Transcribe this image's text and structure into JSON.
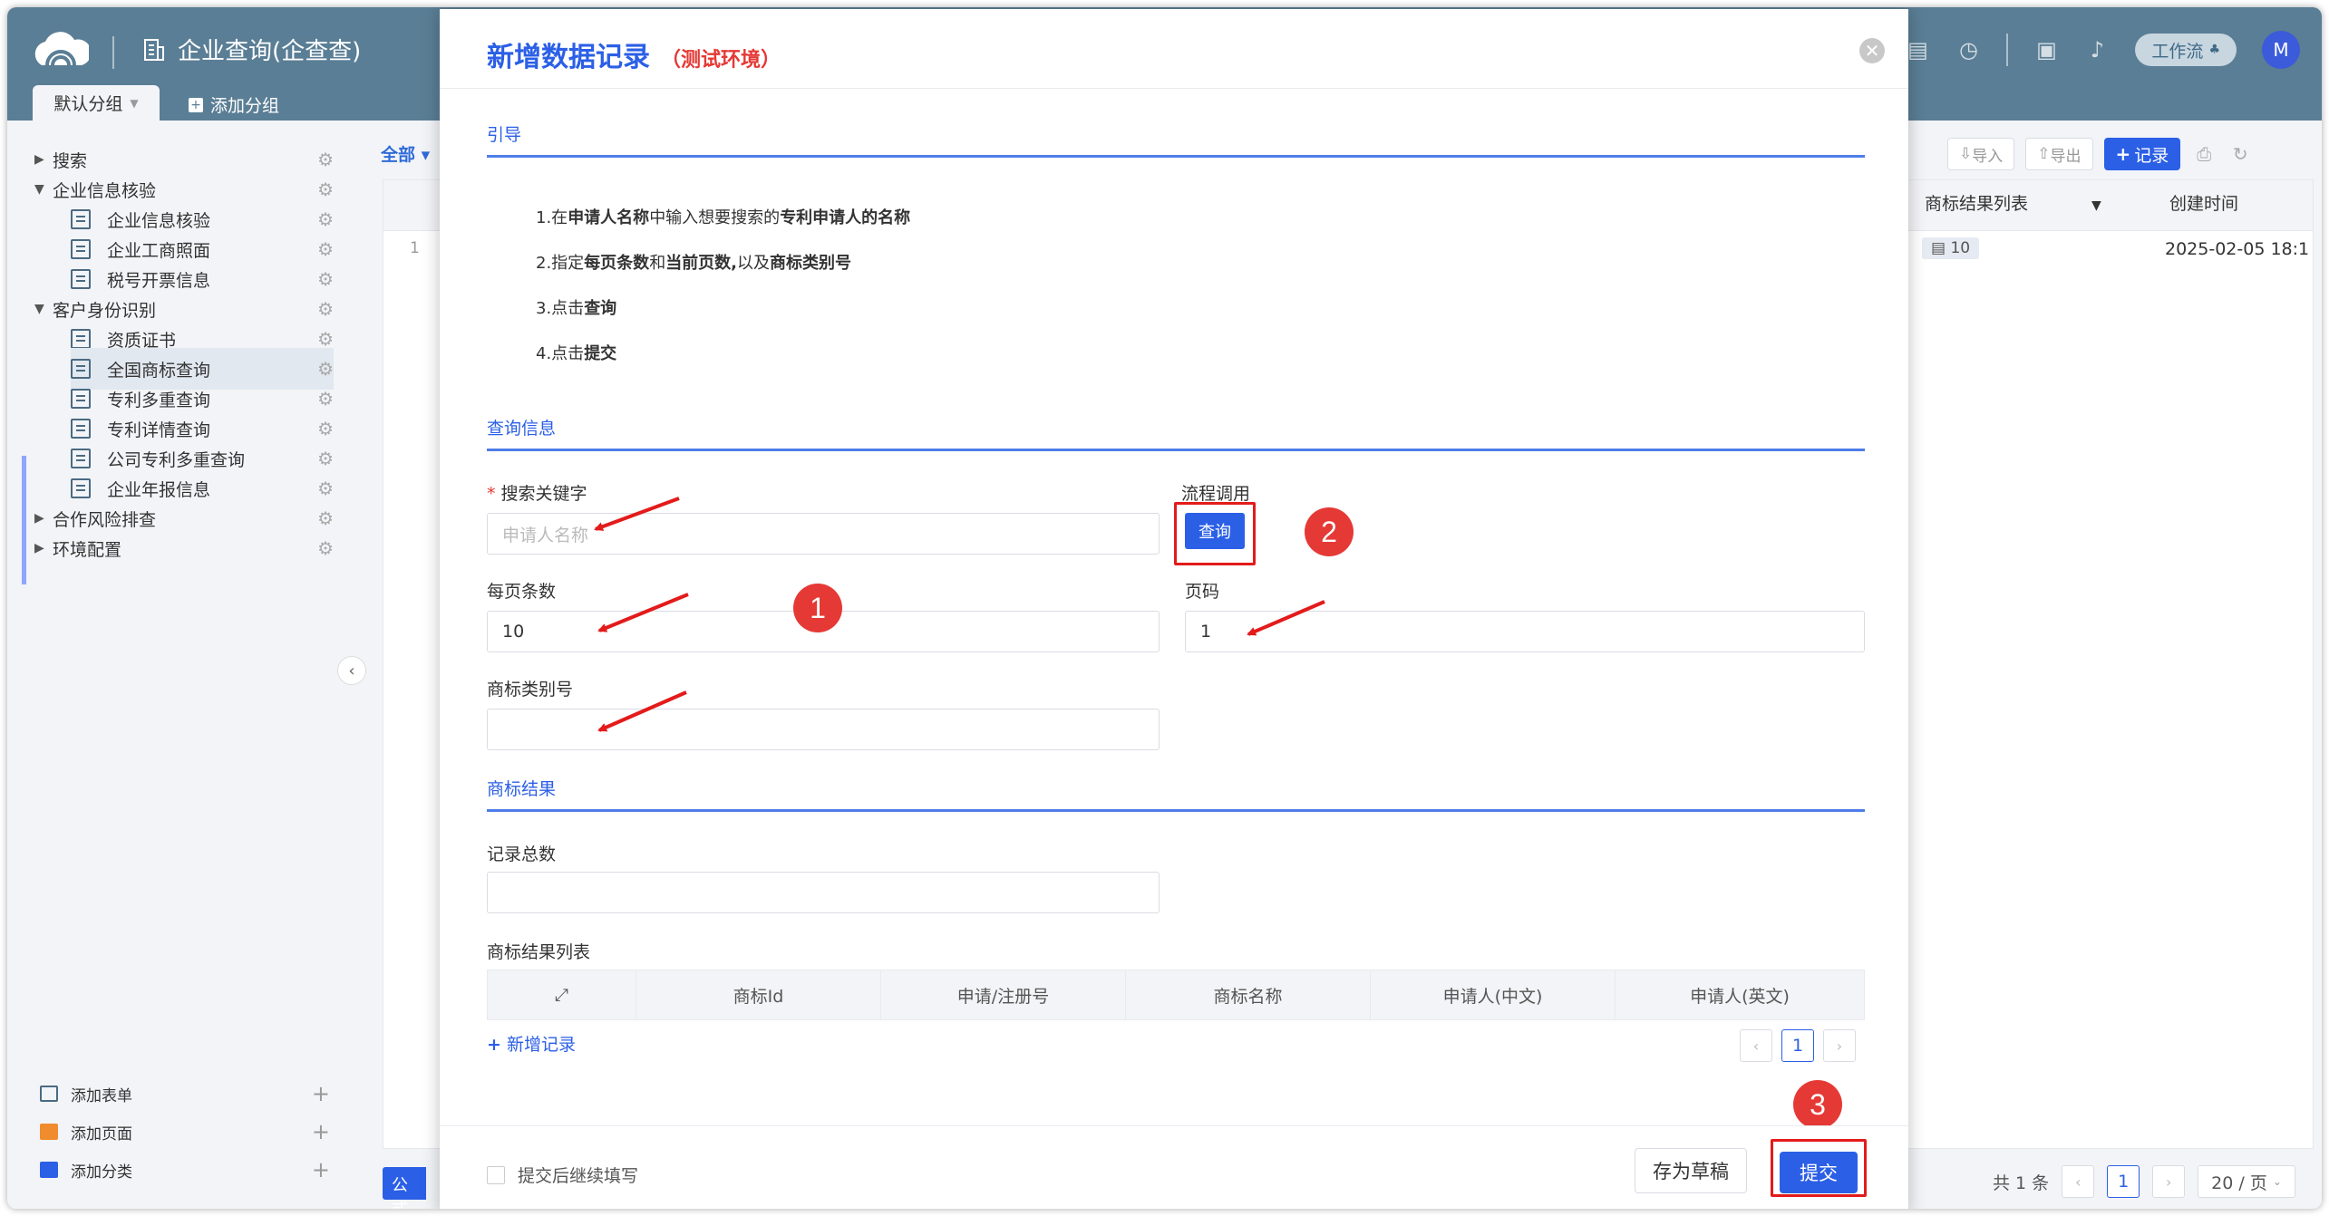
{
  "app": {
    "title": "企业查询(企查查)",
    "tabs": {
      "default_group": "默认分组",
      "add_group": "添加分组"
    },
    "workflow": "工作流",
    "avatar": "M"
  },
  "sidebar": {
    "items": [
      {
        "label": "搜索",
        "type": "group"
      },
      {
        "label": "企业信息核验",
        "type": "group-open"
      },
      {
        "label": "企业信息核验",
        "type": "form"
      },
      {
        "label": "企业工商照面",
        "type": "form"
      },
      {
        "label": "税号开票信息",
        "type": "form"
      },
      {
        "label": "客户身份识别",
        "type": "group-open"
      },
      {
        "label": "资质证书",
        "type": "form"
      },
      {
        "label": "全国商标查询",
        "type": "form",
        "active": true
      },
      {
        "label": "专利多重查询",
        "type": "form"
      },
      {
        "label": "专利详情查询",
        "type": "form"
      },
      {
        "label": "公司专利多重查询",
        "type": "form"
      },
      {
        "label": "企业年报信息",
        "type": "form"
      },
      {
        "label": "合作风险排查",
        "type": "group"
      },
      {
        "label": "环境配置",
        "type": "group"
      }
    ],
    "bottom": {
      "add_form": "添加表单",
      "add_page": "添加页面",
      "add_category": "添加分类"
    }
  },
  "background": {
    "filter_all": "全部",
    "toolbar": {
      "import": "导入",
      "export": "导出",
      "record": "记录"
    },
    "columns": {
      "trademark_list": "商标结果列表",
      "created": "创建时间"
    },
    "row": {
      "num": "1",
      "tag": "10",
      "date": "2025-02-05 18:1"
    },
    "formula": "公式",
    "pager": {
      "total": "共 1 条",
      "page": "1",
      "size": "20 / 页"
    }
  },
  "modal": {
    "title": "新增数据记录",
    "env": "（测试环境）",
    "sections": {
      "guide": "引导",
      "query": "查询信息",
      "result": "商标结果"
    },
    "guide_lines": {
      "l1": {
        "a": "1.在",
        "b": "申请人名称",
        "c": "中输入想要搜索的",
        "d": "专利申请人的名称"
      },
      "l2": {
        "a": "2.指定",
        "b": "每页条数",
        "c": "和",
        "d": "当前页数,",
        "e": "以及",
        "f": "商标类别号"
      },
      "l3": {
        "a": "3.点击",
        "b": "查询"
      },
      "l4": {
        "a": "4.点击",
        "b": "提交"
      }
    },
    "fields": {
      "keyword_label": "搜索关键字",
      "keyword_placeholder": "申请人名称",
      "flow_label": "流程调用",
      "query_button": "查询",
      "page_size_label": "每页条数",
      "page_size_value": "10",
      "page_label": "页码",
      "page_value": "1",
      "class_label": "商标类别号",
      "total_label": "记录总数",
      "list_label": "商标结果列表"
    },
    "table_headers": [
      "商标Id",
      "申请/注册号",
      "商标名称",
      "申请人(中文)",
      "申请人(英文)"
    ],
    "add_record": "新增记录",
    "sub_pager_page": "1",
    "footer": {
      "continue_label": "提交后继续填写",
      "draft": "存为草稿",
      "submit": "提交"
    },
    "badges": {
      "b1": "1",
      "b2": "2",
      "b3": "3"
    }
  },
  "colors": {
    "primary": "#2b5fe6",
    "annotation": "#e31b1b",
    "topbar": "#5a7e95"
  }
}
